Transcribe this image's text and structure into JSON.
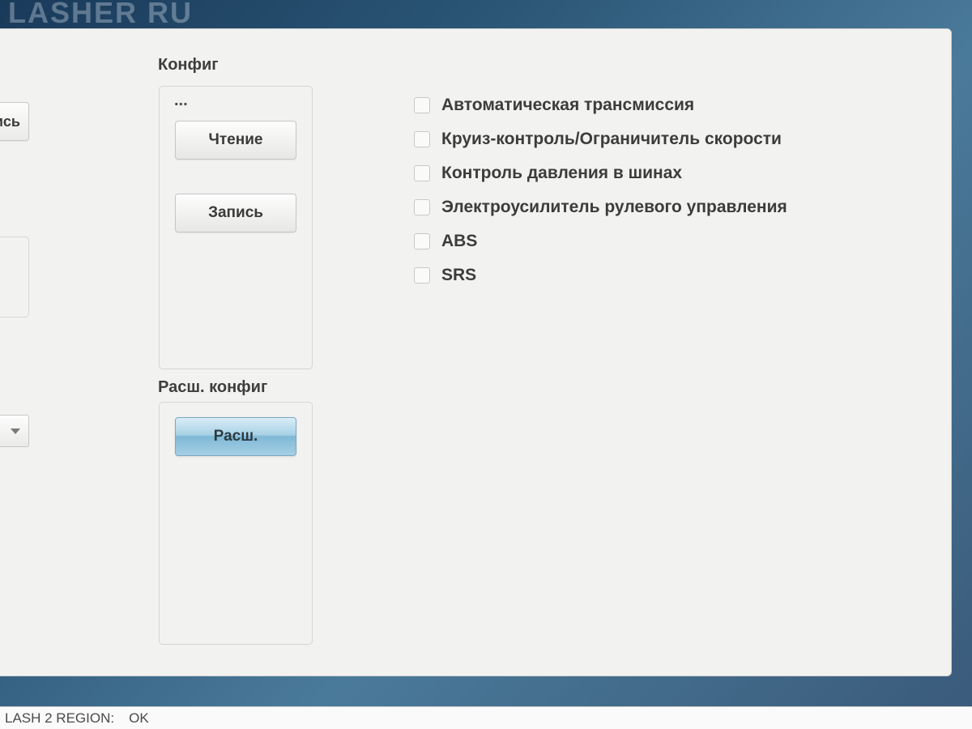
{
  "background": {
    "title_fragment": "LASHER RU"
  },
  "left_edge": {
    "btn_fragment": "ись"
  },
  "config_group": {
    "label": "Конфиг",
    "ellipsis": "...",
    "read_button": "Чтение",
    "write_button": "Запись"
  },
  "ext_config_group": {
    "label": "Расш. конфиг",
    "ext_button": "Расш."
  },
  "options": [
    {
      "label": "Автоматическая трансмиссия",
      "checked": false
    },
    {
      "label": "Круиз-контроль/Ограничитель скорости",
      "checked": false
    },
    {
      "label": "Контроль давления в шинах",
      "checked": false
    },
    {
      "label": "Электроусилитель рулевого управления",
      "checked": false
    },
    {
      "label": "ABS",
      "checked": false
    },
    {
      "label": "SRS",
      "checked": false
    }
  ],
  "status": {
    "text": "LASH 2 REGION:",
    "value": "OK"
  }
}
